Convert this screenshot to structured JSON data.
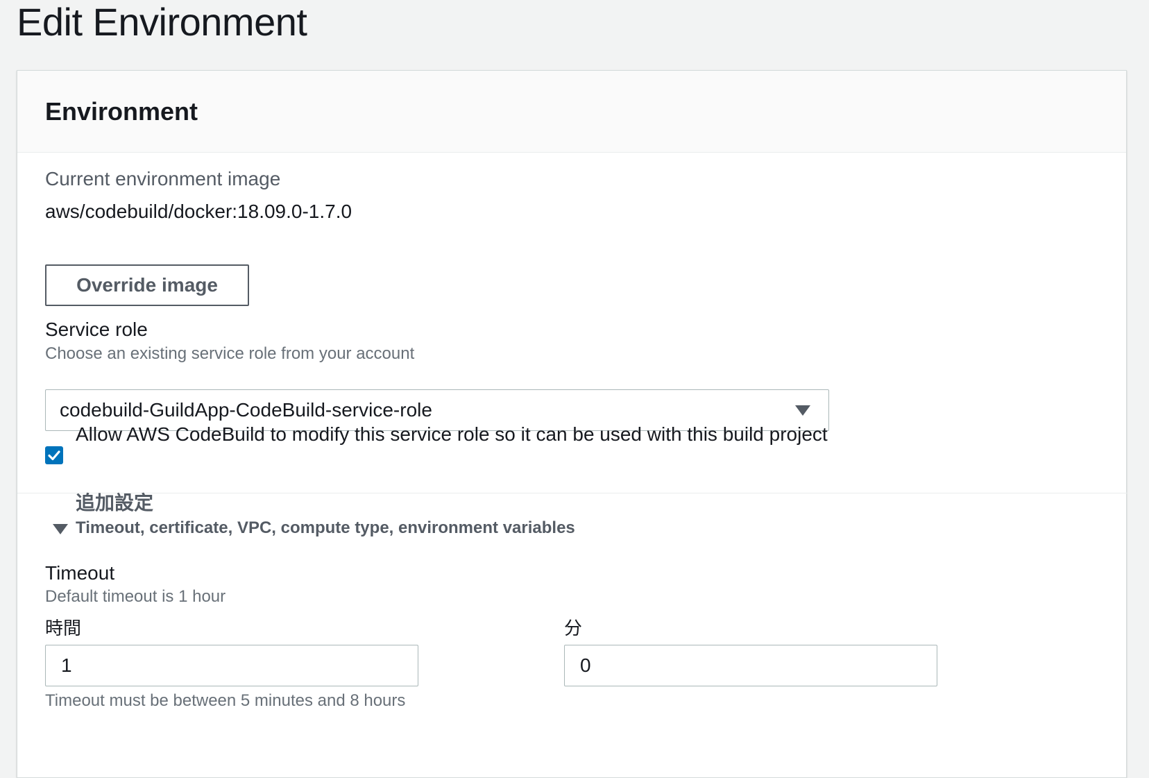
{
  "page": {
    "title": "Edit Environment"
  },
  "panel": {
    "title": "Environment"
  },
  "current_image": {
    "label": "Current environment image",
    "value": "aws/codebuild/docker:18.09.0-1.7.0"
  },
  "override_button": {
    "label": "Override image"
  },
  "service_role": {
    "label": "Service role",
    "description": "Choose an existing service role from your account",
    "selected": "codebuild-GuildApp-CodeBuild-service-role",
    "allow_modify": {
      "checked": true,
      "label": "Allow AWS CodeBuild to modify this service role so it can be used with this build project"
    }
  },
  "additional": {
    "title": "追加設定",
    "subtitle": "Timeout, certificate, VPC, compute type, environment variables"
  },
  "timeout": {
    "label": "Timeout",
    "description": "Default timeout is 1 hour",
    "hours_label": "時間",
    "hours_value": "1",
    "minutes_label": "分",
    "minutes_value": "0",
    "constraint": "Timeout must be between 5 minutes and 8 hours"
  },
  "colors": {
    "accent": "#0073bb",
    "text": "#16191f",
    "muted": "#545b64",
    "background": "#f2f3f3"
  }
}
